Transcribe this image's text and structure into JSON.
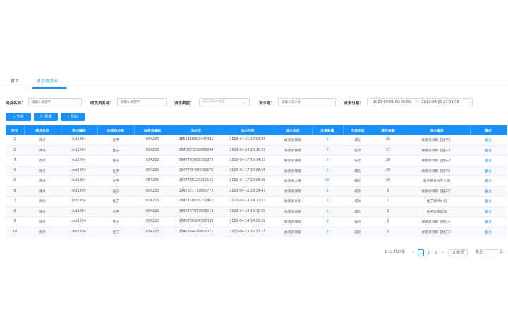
{
  "tabs": {
    "home": "首页",
    "active": "收货员流水"
  },
  "filters": {
    "site_name_label": "网点名称：",
    "site_name_placeholder": "请输入关键字",
    "receiver_name_label": "收货员名称：",
    "receiver_name_placeholder": "请输入关键字",
    "flow_type_label": "流水类型：",
    "flow_type_placeholder": "请选择流水类型",
    "flow_no_label": "流水号：",
    "flow_no_placeholder": "请输入流水号",
    "flow_date_label": "流水日期：",
    "date_start": "2023-04-01 00:00:00",
    "date_sep": "~",
    "date_end": "2023-04-25 23:59:59"
  },
  "buttons": {
    "search": "查询",
    "reset": "重置",
    "export": "导出"
  },
  "table": {
    "headers": [
      "序号",
      "网点名称",
      "网点编码",
      "收货员名称",
      "收货员编码",
      "流水号",
      "流水时间",
      "流水类型",
      "交易数量",
      "交易状态",
      "库存余额",
      "流水描述",
      "操作"
    ],
    "rows": [
      [
        "1",
        "网点",
        "nst1954",
        "住宁",
        "654233",
        "1555318003445431",
        "2023-04-21 17:03:25",
        "收货员领取",
        "1",
        "成功",
        "26",
        "收货员领取【住宁】",
        "备注"
      ],
      [
        "2",
        "网点",
        "nst1954",
        "住宁",
        "654233",
        "1540873232883244",
        "2023-04-20 10:10:23",
        "收货员领取",
        "1",
        "成功",
        "27",
        "收货员领取【住宁】",
        "备注"
      ],
      [
        "3",
        "网点",
        "nst1954",
        "住宁",
        "654233",
        "1547785065352872",
        "2023-04-17 10:14:33",
        "收货员领取",
        "1",
        "成功",
        "28",
        "收货员领取【住宁】",
        "备注"
      ],
      [
        "4",
        "网点",
        "nst1954",
        "住宁",
        "654233",
        "1547765480932576",
        "2023-04-17 10:06:15",
        "收货员领取",
        "1",
        "成功",
        "29",
        "收货员领取【住宁】",
        "备注"
      ],
      [
        "5",
        "网点",
        "nst1954",
        "住宁",
        "654233",
        "1547765127212131",
        "2023-04-17 10:05:06",
        "收货员入库",
        "30",
        "成功",
        "30",
        "客户寄件住宁入库",
        "备注"
      ],
      [
        "6",
        "网点",
        "nst1954",
        "住宁",
        "654233",
        "1547371773867772",
        "2023-04-16 20:34:47",
        "收货员领取",
        "1",
        "成功",
        "0",
        "收货员领取【住宁】",
        "备注"
      ],
      [
        "7",
        "网点",
        "nst1954",
        "住宁",
        "654233",
        "1546758035232465",
        "2023-04-14 14:13:03",
        "收货员补扣",
        "1",
        "成功",
        "1",
        "住宁寄件补扣",
        "备注"
      ],
      [
        "8",
        "网点",
        "nst1954",
        "住宁",
        "654233",
        "1546757877608514",
        "2023-04-14 14:10:03",
        "收货员退货",
        "1",
        "成功",
        "2",
        "住宁退货成功",
        "备注"
      ],
      [
        "9",
        "网点",
        "nst1954",
        "住宁",
        "654233",
        "1546758504387095",
        "2023-04-14 14:05:29",
        "收货员领取",
        "1",
        "成功",
        "1",
        "收货员领取【住宁】",
        "备注"
      ],
      [
        "10",
        "网点",
        "nst1954",
        "住宁",
        "654233",
        "1546384419805071",
        "2023-04-13 10:37:15",
        "收货员领取",
        "1",
        "成功",
        "2",
        "收货员领取【住宁】",
        "备注"
      ]
    ]
  },
  "pagination": {
    "summary": "1-10 共25条",
    "prev": "‹",
    "pages": [
      "1",
      "2",
      "3"
    ],
    "next": "›",
    "page_size": "10 条/页",
    "jump_label": "跳至",
    "jump_suffix": "页"
  },
  "icons": {
    "search": "search-icon",
    "reset": "refresh-icon",
    "export": "export-icon",
    "select": "chevron-down-icon"
  },
  "colors": {
    "primary": "#1890ff",
    "header_text": "#ffffff"
  }
}
